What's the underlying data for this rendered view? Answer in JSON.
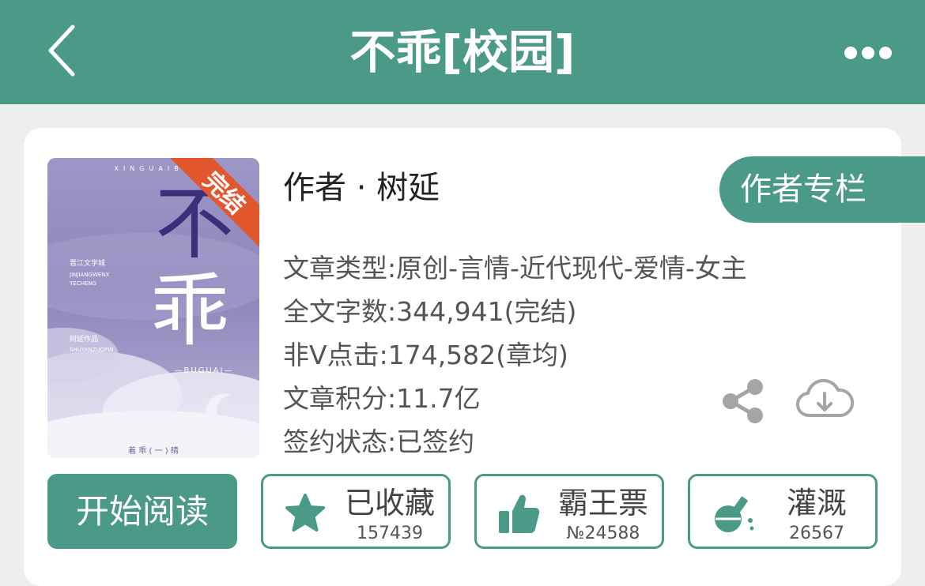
{
  "header": {
    "title": "不乖[校园]",
    "back_icon": "chevron-left-icon",
    "more_icon": "more-horizontal-icon"
  },
  "book": {
    "author_line": "作者 · 树延",
    "author_column_label": "作者专栏",
    "cover": {
      "badge": "完结",
      "title_chars": [
        "不",
        "乖"
      ],
      "pinyin": "—BUGUAI—",
      "top_letters": "XINGUAIBU",
      "series_cn": "晋江文学城",
      "series_en_1": "JINJIANGWENX",
      "series_en_2": "YECHENG",
      "author_cn": "树延作品",
      "author_en": "SHUYANZUOPIN",
      "bottom_text": "着 乖 ( 一 ) 晴"
    },
    "info": [
      {
        "label": "文章类型:",
        "value": "原创-言情-近代现代-爱情-女主"
      },
      {
        "label": "全文字数:",
        "value": "344,941(完结)"
      },
      {
        "label": "非V点击:",
        "value": "174,582(章均)"
      },
      {
        "label": "文章积分:",
        "value": "11.7亿"
      },
      {
        "label": "签约状态:",
        "value": "已签约"
      }
    ],
    "share_icon": "share-icon",
    "download_icon": "cloud-download-icon"
  },
  "actions": {
    "read_label": "开始阅读",
    "items": [
      {
        "label": "已收藏",
        "count": "157439",
        "icon": "star-icon"
      },
      {
        "label": "霸王票",
        "count": "№24588",
        "icon": "thumbs-up-icon"
      },
      {
        "label": "灌溉",
        "count": "26567",
        "icon": "watering-flask-icon"
      }
    ]
  },
  "colors": {
    "accent": "#4b9987",
    "background": "#eeeeee",
    "card": "#ffffff",
    "badge": "#e2572d",
    "icon_gray": "#a5a5a5"
  }
}
